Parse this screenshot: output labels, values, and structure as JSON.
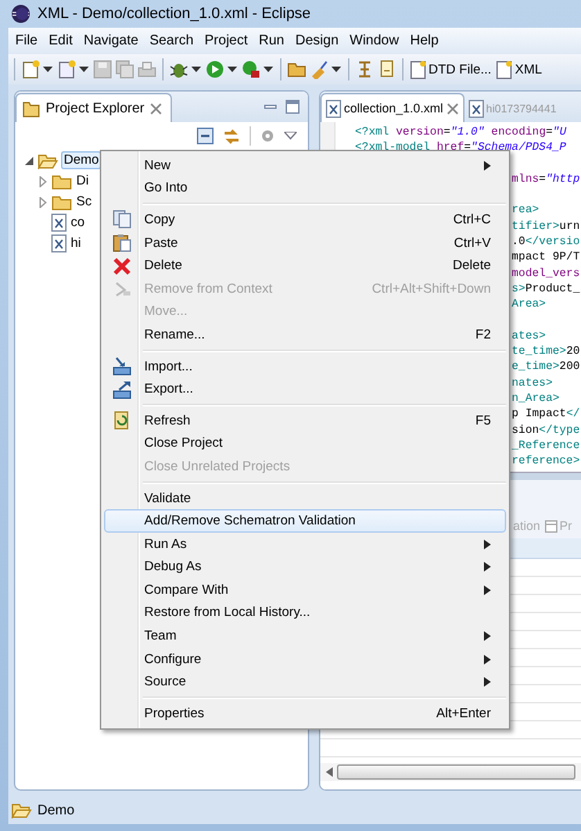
{
  "window": {
    "title": "XML - Demo/collection_1.0.xml - Eclipse"
  },
  "menu_bar": [
    "File",
    "Edit",
    "Navigate",
    "Search",
    "Project",
    "Run",
    "Design",
    "Window",
    "Help"
  ],
  "toolbar": {
    "buttons": [
      {
        "label": "DTD File..."
      },
      {
        "label": "XML"
      }
    ]
  },
  "project_explorer": {
    "title": "Project Explorer",
    "tree": [
      {
        "label": "Demo",
        "kind": "folder",
        "expanded": true,
        "selected": true,
        "children": [
          {
            "label": "Di",
            "kind": "folder",
            "expanded": false,
            "selected": false
          },
          {
            "label": "Sc",
            "kind": "folder",
            "expanded": false,
            "selected": false
          },
          {
            "label": "co",
            "kind": "file",
            "selected": false
          },
          {
            "label": "hi",
            "kind": "file",
            "selected": false
          }
        ]
      }
    ]
  },
  "editor": {
    "tabs": [
      {
        "label": "collection_1.0.xml",
        "selected": true
      },
      {
        "label": "hi0173794441",
        "selected": false
      }
    ],
    "lines": [
      {
        "kind": "full",
        "segments": [
          {
            "kind": "tag",
            "text": "<?xml"
          },
          {
            "kind": "attr",
            "text": " version"
          },
          {
            "kind": "text",
            "text": "="
          },
          {
            "kind": "string",
            "text": "\"1.0\""
          },
          {
            "kind": "attr",
            "text": " encoding"
          },
          {
            "kind": "text",
            "text": "="
          },
          {
            "kind": "string",
            "text": "\"U"
          }
        ]
      },
      {
        "kind": "full",
        "segments": [
          {
            "kind": "tag",
            "text": "<?xml-model"
          },
          {
            "kind": "attr",
            "text": " href"
          },
          {
            "kind": "text",
            "text": "="
          },
          {
            "kind": "string",
            "text": "\"Schema/PDS4_P"
          }
        ]
      },
      {
        "kind": "blank"
      },
      {
        "kind": "partial",
        "segments": [
          {
            "kind": "attr",
            "text": "mlns"
          },
          {
            "kind": "text",
            "text": "="
          },
          {
            "kind": "string",
            "text": "\"http"
          }
        ]
      },
      {
        "kind": "blank"
      },
      {
        "kind": "partial",
        "segments": [
          {
            "kind": "tag",
            "text": "rea>"
          }
        ]
      },
      {
        "kind": "partial",
        "segments": [
          {
            "kind": "tag",
            "text": "tifier>"
          },
          {
            "kind": "text",
            "text": "urn"
          }
        ]
      },
      {
        "kind": "partial",
        "segments": [
          {
            "kind": "text",
            "text": ".0"
          },
          {
            "kind": "tag",
            "text": "</versio"
          }
        ]
      },
      {
        "kind": "partial",
        "segments": [
          {
            "kind": "text",
            "text": "mpact 9P/T"
          }
        ]
      },
      {
        "kind": "partial",
        "segments": [
          {
            "kind": "attr",
            "text": "model_vers"
          }
        ]
      },
      {
        "kind": "partial",
        "segments": [
          {
            "kind": "tag",
            "text": "s>"
          },
          {
            "kind": "text",
            "text": "Product_"
          }
        ]
      },
      {
        "kind": "partial",
        "segments": [
          {
            "kind": "tag",
            "text": "Area>"
          }
        ]
      },
      {
        "kind": "blank"
      },
      {
        "kind": "partial",
        "segments": [
          {
            "kind": "tag",
            "text": "ates>"
          }
        ]
      },
      {
        "kind": "partial",
        "segments": [
          {
            "kind": "tag",
            "text": "te_time>"
          },
          {
            "kind": "text",
            "text": "20"
          }
        ]
      },
      {
        "kind": "partial",
        "segments": [
          {
            "kind": "tag",
            "text": "e_time>"
          },
          {
            "kind": "text",
            "text": "200"
          }
        ]
      },
      {
        "kind": "partial",
        "segments": [
          {
            "kind": "tag",
            "text": "nates>"
          }
        ]
      },
      {
        "kind": "partial",
        "segments": [
          {
            "kind": "tag",
            "text": "n_Area>"
          }
        ]
      },
      {
        "kind": "partial",
        "segments": [
          {
            "kind": "text",
            "text": "p Impact"
          },
          {
            "kind": "tag",
            "text": "</"
          }
        ]
      },
      {
        "kind": "partial",
        "segments": [
          {
            "kind": "text",
            "text": "sion"
          },
          {
            "kind": "tag",
            "text": "</type"
          }
        ]
      },
      {
        "kind": "partial",
        "segments": [
          {
            "kind": "tag",
            "text": "_Reference"
          }
        ]
      },
      {
        "kind": "partial",
        "segments": [
          {
            "kind": "tag",
            "text": "reference>"
          }
        ]
      }
    ]
  },
  "bottom_panel": {
    "tabs": [
      {
        "label": "ation"
      },
      {
        "label": "Pr"
      }
    ]
  },
  "context_menu": {
    "items": [
      {
        "kind": "item",
        "label": "New",
        "submenu": true,
        "disabled": false,
        "selected": false
      },
      {
        "kind": "item",
        "label": "Go Into",
        "disabled": false,
        "selected": false
      },
      {
        "kind": "separator"
      },
      {
        "kind": "item",
        "label": "Copy",
        "shortcut": "Ctrl+C",
        "disabled": false,
        "selected": false
      },
      {
        "kind": "item",
        "label": "Paste",
        "shortcut": "Ctrl+V",
        "disabled": false,
        "selected": false
      },
      {
        "kind": "item",
        "label": "Delete",
        "shortcut": "Delete",
        "disabled": false,
        "selected": false
      },
      {
        "kind": "item",
        "label": "Remove from Context",
        "shortcut": "Ctrl+Alt+Shift+Down",
        "disabled": true,
        "selected": false
      },
      {
        "kind": "item",
        "label": "Move...",
        "disabled": true,
        "selected": false
      },
      {
        "kind": "item",
        "label": "Rename...",
        "shortcut": "F2",
        "disabled": false,
        "selected": false
      },
      {
        "kind": "separator"
      },
      {
        "kind": "item",
        "label": "Import...",
        "disabled": false,
        "selected": false
      },
      {
        "kind": "item",
        "label": "Export...",
        "disabled": false,
        "selected": false
      },
      {
        "kind": "separator"
      },
      {
        "kind": "item",
        "label": "Refresh",
        "shortcut": "F5",
        "disabled": false,
        "selected": false
      },
      {
        "kind": "item",
        "label": "Close Project",
        "disabled": false,
        "selected": false
      },
      {
        "kind": "item",
        "label": "Close Unrelated Projects",
        "disabled": true,
        "selected": false
      },
      {
        "kind": "separator"
      },
      {
        "kind": "item",
        "label": "Validate",
        "disabled": false,
        "selected": false
      },
      {
        "kind": "item",
        "label": "Add/Remove Schematron Validation",
        "disabled": false,
        "selected": true
      },
      {
        "kind": "item",
        "label": "Run As",
        "submenu": true,
        "disabled": false,
        "selected": false
      },
      {
        "kind": "item",
        "label": "Debug As",
        "submenu": true,
        "disabled": false,
        "selected": false
      },
      {
        "kind": "item",
        "label": "Compare With",
        "submenu": true,
        "disabled": false,
        "selected": false
      },
      {
        "kind": "item",
        "label": "Restore from Local History...",
        "disabled": false,
        "selected": false
      },
      {
        "kind": "item",
        "label": "Team",
        "submenu": true,
        "disabled": false,
        "selected": false
      },
      {
        "kind": "item",
        "label": "Configure",
        "submenu": true,
        "disabled": false,
        "selected": false
      },
      {
        "kind": "item",
        "label": "Source",
        "submenu": true,
        "disabled": false,
        "selected": false
      },
      {
        "kind": "separator"
      },
      {
        "kind": "item",
        "label": "Properties",
        "shortcut": "Alt+Enter",
        "disabled": false,
        "selected": false
      }
    ]
  },
  "status_bar": {
    "text": "Demo"
  }
}
